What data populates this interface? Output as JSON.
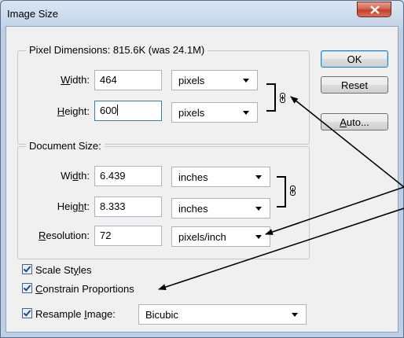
{
  "window": {
    "title": "Image Size"
  },
  "pixel_dimensions": {
    "legend": "Pixel Dimensions:  815.6K (was 24.1M)",
    "width": {
      "label_pre": "",
      "label_key": "W",
      "label_post": "idth:",
      "value": "464",
      "unit": "pixels"
    },
    "height": {
      "label_pre": "",
      "label_key": "H",
      "label_post": "eight:",
      "value": "600",
      "unit": "pixels"
    }
  },
  "document_size": {
    "legend": "Document Size:",
    "width": {
      "label_pre": "Wi",
      "label_key": "d",
      "label_post": "th:",
      "value": "6.439",
      "unit": "inches"
    },
    "height": {
      "label_pre": "Heig",
      "label_key": "h",
      "label_post": "t:",
      "value": "8.333",
      "unit": "inches"
    },
    "resolution": {
      "label_pre": "",
      "label_key": "R",
      "label_post": "esolution:",
      "value": "72",
      "unit": "pixels/inch"
    }
  },
  "buttons": {
    "ok": "OK",
    "reset": "Reset",
    "auto_key": "A",
    "auto_rest": "uto..."
  },
  "options": {
    "scale_styles": {
      "pre": "Scale St",
      "key": "y",
      "post": "les",
      "checked": true
    },
    "constrain": {
      "pre": "",
      "key": "C",
      "post": "onstrain Proportions",
      "checked": true
    },
    "resample": {
      "pre": "Resample ",
      "key": "I",
      "post": "mage:",
      "checked": true,
      "method": "Bicubic"
    }
  },
  "icons": {
    "close": "close-icon",
    "link": "chain-link-icon",
    "dropdown": "chevron-down-icon",
    "check": "checkmark-icon"
  },
  "colors": {
    "annotation_arrow": "#000000",
    "close_button": "#c43f2a",
    "focus_border": "#3d7bad"
  }
}
